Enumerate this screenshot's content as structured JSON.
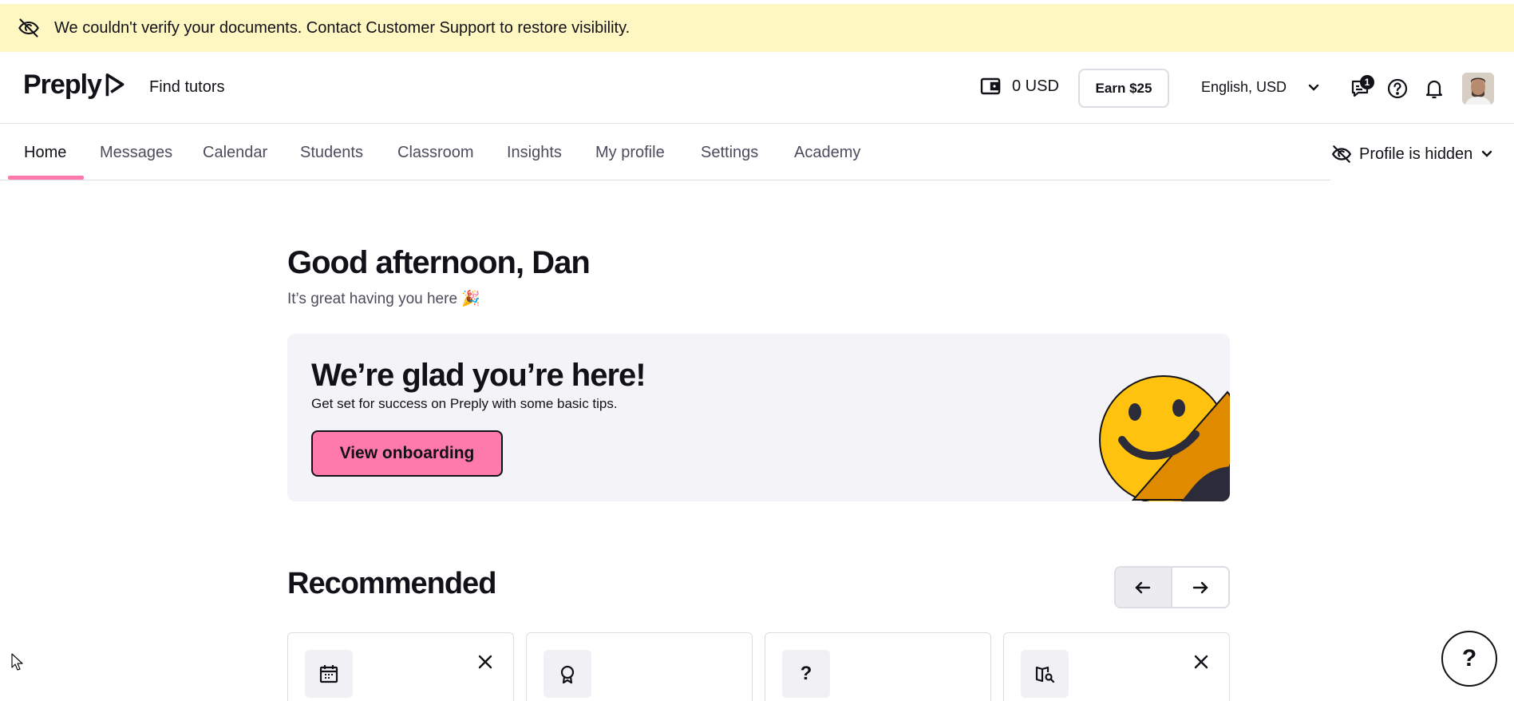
{
  "banner": {
    "text": "We couldn't verify your documents. Contact Customer Support to restore visibility.",
    "icon": "eye-off-icon"
  },
  "header": {
    "logo_text": "Preply",
    "find_tutors": "Find tutors",
    "balance": "0 USD",
    "earn_label": "Earn $25",
    "language": "English, USD",
    "messages_badge": "1"
  },
  "nav": {
    "tabs": [
      "Home",
      "Messages",
      "Calendar",
      "Students",
      "Classroom",
      "Insights",
      "My profile",
      "Settings",
      "Academy"
    ],
    "active_tab": "Home",
    "profile_status": "Profile is hidden"
  },
  "greeting": {
    "title": "Good afternoon, Dan",
    "subtitle": "It’s great having you here 🎉"
  },
  "onboarding": {
    "title": "We’re glad you’re here!",
    "subtitle": "Get set for success on Preply with some basic tips.",
    "button": "View onboarding"
  },
  "recommended": {
    "title": "Recommended",
    "cards": [
      {
        "icon": "calendar-icon",
        "dismissable": true
      },
      {
        "icon": "award-icon",
        "dismissable": false
      },
      {
        "icon": "question-icon",
        "glyph": "?",
        "dismissable": false
      },
      {
        "icon": "book-search-icon",
        "dismissable": true
      }
    ]
  },
  "help_fab": "?",
  "colors": {
    "banner_bg": "#fff7c2",
    "accent_pink": "#ff7aac",
    "card_bg": "#f4f4f8",
    "text": "#121117"
  }
}
